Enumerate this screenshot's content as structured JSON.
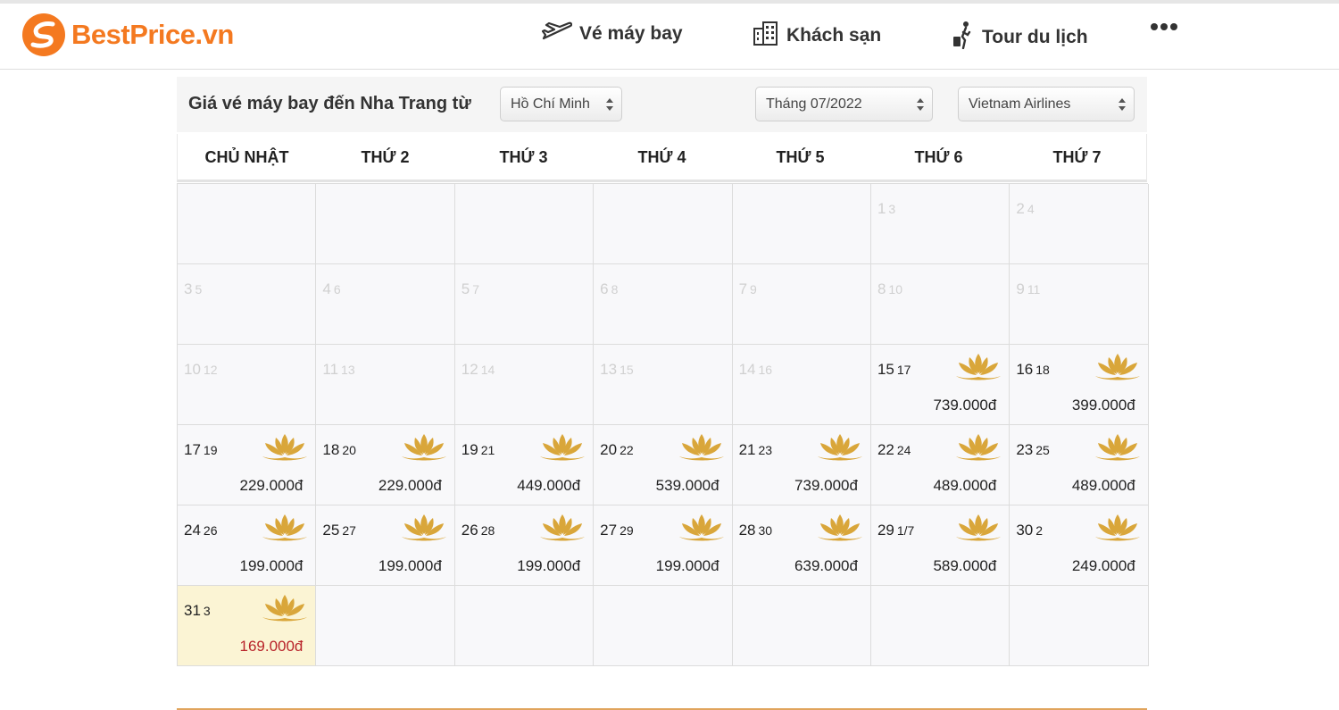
{
  "brand": {
    "name": "BestPrice.vn",
    "accent": "#f47920"
  },
  "nav": [
    {
      "label": "Vé máy bay",
      "icon": "plane-icon"
    },
    {
      "label": "Khách sạn",
      "icon": "building-icon"
    },
    {
      "label": "Tour du lịch",
      "icon": "traveler-icon"
    }
  ],
  "toolbar": {
    "title": "Giá vé máy bay đến Nha Trang từ",
    "origin": "Hồ Chí Minh",
    "month": "Tháng 07/2022",
    "airline": "Vietnam Airlines"
  },
  "weekdays": [
    "CHỦ NHẬT",
    "THỨ 2",
    "THỨ 3",
    "THỨ 4",
    "THỨ 5",
    "THỨ 6",
    "THỨ 7"
  ],
  "calendar": {
    "leading_empty": 5,
    "days": [
      {
        "day": "1",
        "lunar": "3",
        "past": true
      },
      {
        "day": "2",
        "lunar": "4",
        "past": true
      },
      {
        "day": "3",
        "lunar": "5",
        "past": true
      },
      {
        "day": "4",
        "lunar": "6",
        "past": true
      },
      {
        "day": "5",
        "lunar": "7",
        "past": true
      },
      {
        "day": "6",
        "lunar": "8",
        "past": true
      },
      {
        "day": "7",
        "lunar": "9",
        "past": true
      },
      {
        "day": "8",
        "lunar": "10",
        "past": true
      },
      {
        "day": "9",
        "lunar": "11",
        "past": true
      },
      {
        "day": "10",
        "lunar": "12",
        "past": true
      },
      {
        "day": "11",
        "lunar": "13",
        "past": true
      },
      {
        "day": "12",
        "lunar": "14",
        "past": true
      },
      {
        "day": "13",
        "lunar": "15",
        "past": true
      },
      {
        "day": "14",
        "lunar": "16",
        "past": true
      },
      {
        "day": "15",
        "lunar": "17",
        "price": "739.000đ"
      },
      {
        "day": "16",
        "lunar": "18",
        "price": "399.000đ"
      },
      {
        "day": "17",
        "lunar": "19",
        "price": "229.000đ"
      },
      {
        "day": "18",
        "lunar": "20",
        "price": "229.000đ"
      },
      {
        "day": "19",
        "lunar": "21",
        "price": "449.000đ"
      },
      {
        "day": "20",
        "lunar": "22",
        "price": "539.000đ"
      },
      {
        "day": "21",
        "lunar": "23",
        "price": "739.000đ"
      },
      {
        "day": "22",
        "lunar": "24",
        "price": "489.000đ"
      },
      {
        "day": "23",
        "lunar": "25",
        "price": "489.000đ"
      },
      {
        "day": "24",
        "lunar": "26",
        "price": "199.000đ"
      },
      {
        "day": "25",
        "lunar": "27",
        "price": "199.000đ"
      },
      {
        "day": "26",
        "lunar": "28",
        "price": "199.000đ"
      },
      {
        "day": "27",
        "lunar": "29",
        "price": "199.000đ"
      },
      {
        "day": "28",
        "lunar": "30",
        "price": "639.000đ"
      },
      {
        "day": "29",
        "lunar": "1/7",
        "price": "589.000đ"
      },
      {
        "day": "30",
        "lunar": "2",
        "price": "249.000đ"
      },
      {
        "day": "31",
        "lunar": "3",
        "price": "169.000đ",
        "cheapest": true
      }
    ],
    "trailing_empty": 6
  },
  "colors": {
    "cheapest_bg": "#fbf4d4",
    "cheapest_price": "#b8232a",
    "lotus": "#d9a63a"
  }
}
